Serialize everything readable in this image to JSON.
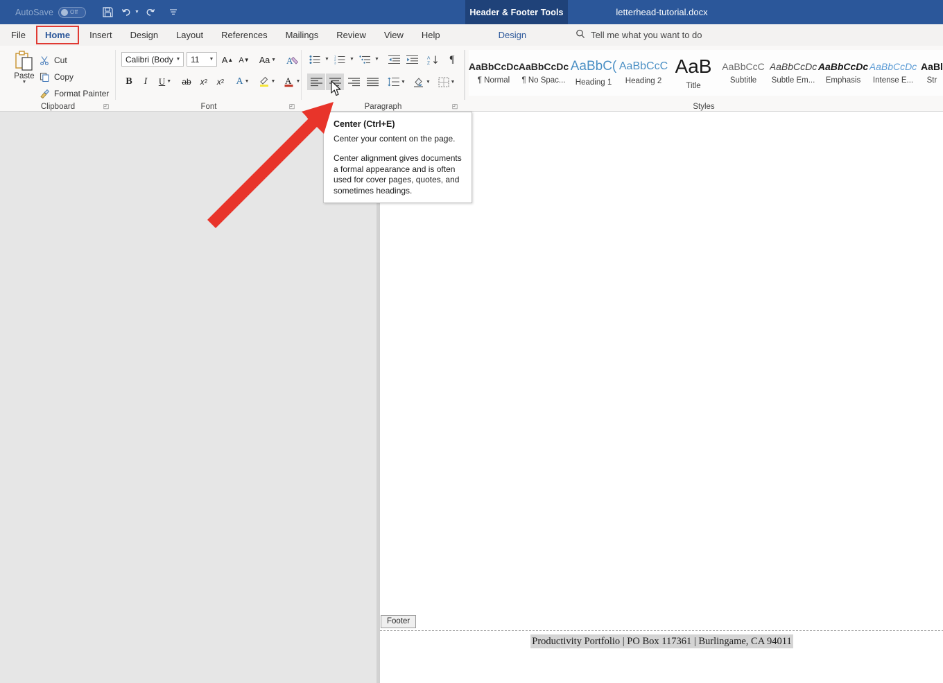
{
  "titlebar": {
    "autosave_label": "AutoSave",
    "autosave_state": "Off",
    "contextual_tab": "Header & Footer Tools",
    "document_title": "letterhead-tutorial.docx",
    "qat": [
      {
        "name": "save-icon",
        "label": "Save"
      },
      {
        "name": "undo-icon",
        "label": "Undo"
      },
      {
        "name": "redo-icon",
        "label": "Redo"
      },
      {
        "name": "customize-qat-icon",
        "label": "Customize Quick Access Toolbar"
      }
    ],
    "accent_color": "#2b579a",
    "contextual_color": "#1f4279"
  },
  "tabs": [
    {
      "label": "File"
    },
    {
      "label": "Home"
    },
    {
      "label": "Insert"
    },
    {
      "label": "Design"
    },
    {
      "label": "Layout"
    },
    {
      "label": "References"
    },
    {
      "label": "Mailings"
    },
    {
      "label": "Review"
    },
    {
      "label": "View"
    },
    {
      "label": "Help"
    }
  ],
  "contextual_tab_label": "Design",
  "active_tab": "Home",
  "highlight_color": "#e03a33",
  "tellme": {
    "icon": "search-icon",
    "placeholder": "Tell me what you want to do"
  },
  "ribbon": {
    "groups": [
      {
        "label": "Clipboard"
      },
      {
        "label": "Font"
      },
      {
        "label": "Paragraph"
      },
      {
        "label": "Styles"
      }
    ],
    "clipboard": {
      "paste_label": "Paste",
      "items": [
        {
          "icon": "cut-icon",
          "label": "Cut"
        },
        {
          "icon": "copy-icon",
          "label": "Copy"
        },
        {
          "icon": "format-painter-icon",
          "label": "Format Painter"
        }
      ]
    },
    "font": {
      "font_family": "Calibri (Body)",
      "font_size": "11",
      "grow_font": "A",
      "shrink_font": "A",
      "change_case": "Aa",
      "clear_formatting": "A",
      "bold": "B",
      "italic": "I",
      "underline": "U",
      "strikethrough": "ab",
      "subscript": "x",
      "superscript": "x",
      "text_effects": "A",
      "highlight": "A",
      "font_color": "A"
    },
    "paragraph": {
      "bullets": "bullets-icon",
      "numbering": "numbering-icon",
      "multilevel": "multilevel-list-icon",
      "decrease_indent": "decrease-indent-icon",
      "increase_indent": "increase-indent-icon",
      "sort": "sort-icon",
      "show_marks": "show-formatting-marks-icon",
      "align_left": "align-left-icon",
      "align_center": "align-center-icon",
      "align_right": "align-right-icon",
      "align_justify": "align-justify-icon",
      "line_spacing": "line-spacing-icon",
      "shading": "shading-icon",
      "borders": "borders-icon",
      "selected_alignment": "align_left",
      "hovered_alignment": "align_center"
    },
    "styles": [
      {
        "preview": "AaBbCcDc",
        "name": "¶ Normal",
        "color": "#262626",
        "weight": "bold",
        "style": "normal",
        "size": "14px"
      },
      {
        "preview": "AaBbCcDc",
        "name": "¶ No Spac...",
        "color": "#262626",
        "weight": "bold",
        "style": "normal",
        "size": "14px"
      },
      {
        "preview": "AaBbC(",
        "name": "Heading 1",
        "color": "#4a8fc4",
        "weight": "normal",
        "style": "normal",
        "size": "18px"
      },
      {
        "preview": "AaBbCcC",
        "name": "Heading 2",
        "color": "#4a8fc4",
        "weight": "normal",
        "style": "normal",
        "size": "15px"
      },
      {
        "preview": "AaB",
        "name": "Title",
        "color": "#1a1a1a",
        "weight": "normal",
        "style": "normal",
        "size": "27px"
      },
      {
        "preview": "AaBbCcC",
        "name": "Subtitle",
        "color": "#5a5a5a",
        "weight": "normal",
        "style": "normal",
        "size": "14px"
      },
      {
        "preview": "AaBbCcDc",
        "name": "Subtle Em...",
        "color": "#3d3d3d",
        "weight": "normal",
        "style": "italic",
        "size": "14px"
      },
      {
        "preview": "AaBbCcDc",
        "name": "Emphasis",
        "color": "#1a1a1a",
        "weight": "bold",
        "style": "italic",
        "size": "14px"
      },
      {
        "preview": "AaBbCcDc",
        "name": "Intense E...",
        "color": "#5b9bd5",
        "weight": "normal",
        "style": "italic",
        "size": "14px"
      },
      {
        "preview": "AaBl",
        "name": "Str",
        "color": "#1a1a1a",
        "weight": "bold",
        "style": "normal",
        "size": "14px"
      }
    ]
  },
  "tooltip": {
    "title": "Center (Ctrl+E)",
    "subtitle": "Center your content on the page.",
    "body": "Center alignment gives documents a formal appearance and is often used for cover pages, quotes, and sometimes headings."
  },
  "document": {
    "footer_tag": "Footer",
    "footer_text": "Productivity Portfolio | PO Box 117361 | Burlingame, CA 94011"
  },
  "annotation": {
    "arrow_color": "#e8342a",
    "arrow_name": "red-pointer-arrow"
  }
}
